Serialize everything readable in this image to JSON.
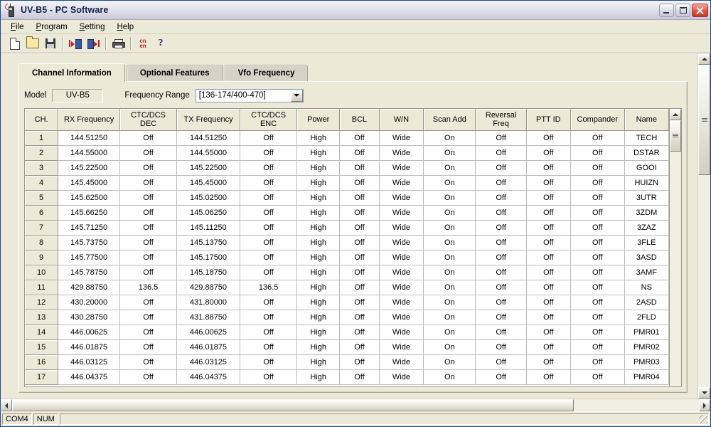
{
  "window": {
    "title": "UV-B5 - PC Software",
    "app_icon": "handheld-radio-icon",
    "minimize_label": "Minimize",
    "restore_label": "Restore",
    "close_label": "Close"
  },
  "menu": [
    {
      "label": "File",
      "accel": "F",
      "rest": "ile"
    },
    {
      "label": "Program",
      "accel": "P",
      "rest": "rogram"
    },
    {
      "label": "Setting",
      "accel": "S",
      "rest": "etting"
    },
    {
      "label": "Help",
      "accel": "H",
      "rest": "elp"
    }
  ],
  "toolbar": {
    "buttons": [
      "new-document-icon",
      "open-folder-icon",
      "save-floppy-icon",
      "read-from-radio-icon",
      "write-to-radio-icon",
      "print-icon",
      "language-cn-en-icon",
      "help-question-icon"
    ],
    "language_top": "cn",
    "language_bottom": "en",
    "help_glyph": "?"
  },
  "tabs": [
    {
      "label": "Channel Information",
      "active": true
    },
    {
      "label": "Optional Features",
      "active": false
    },
    {
      "label": "Vfo Frequency",
      "active": false
    }
  ],
  "fields": {
    "model_label": "Model",
    "model_value": "UV-B5",
    "frequency_range_label": "Frequency Range",
    "frequency_range_value": "[136-174/400-470]"
  },
  "grid": {
    "columns": [
      "CH.",
      "RX Frequency",
      "CTC/DCS DEC",
      "TX Frequency",
      "CTC/DCS ENC",
      "Power",
      "BCL",
      "W/N",
      "Scan Add",
      "Reversal Freq",
      "PTT ID",
      "Compander",
      "Name"
    ],
    "rows": [
      [
        "1",
        "144.51250",
        "Off",
        "144.51250",
        "Off",
        "High",
        "Off",
        "Wide",
        "On",
        "Off",
        "Off",
        "Off",
        "TECH"
      ],
      [
        "2",
        "144.55000",
        "Off",
        "144.55000",
        "Off",
        "High",
        "Off",
        "Wide",
        "On",
        "Off",
        "Off",
        "Off",
        "DSTAR"
      ],
      [
        "3",
        "145.22500",
        "Off",
        "145.22500",
        "Off",
        "High",
        "Off",
        "Wide",
        "On",
        "Off",
        "Off",
        "Off",
        "GOOI"
      ],
      [
        "4",
        "145.45000",
        "Off",
        "145.45000",
        "Off",
        "High",
        "Off",
        "Wide",
        "On",
        "Off",
        "Off",
        "Off",
        "HUIZN"
      ],
      [
        "5",
        "145.62500",
        "Off",
        "145.02500",
        "Off",
        "High",
        "Off",
        "Wide",
        "On",
        "Off",
        "Off",
        "Off",
        "3UTR"
      ],
      [
        "6",
        "145.66250",
        "Off",
        "145.06250",
        "Off",
        "High",
        "Off",
        "Wide",
        "On",
        "Off",
        "Off",
        "Off",
        "3ZDM"
      ],
      [
        "7",
        "145.71250",
        "Off",
        "145.11250",
        "Off",
        "High",
        "Off",
        "Wide",
        "On",
        "Off",
        "Off",
        "Off",
        "3ZAZ"
      ],
      [
        "8",
        "145.73750",
        "Off",
        "145.13750",
        "Off",
        "High",
        "Off",
        "Wide",
        "On",
        "Off",
        "Off",
        "Off",
        "3FLE"
      ],
      [
        "9",
        "145.77500",
        "Off",
        "145.17500",
        "Off",
        "High",
        "Off",
        "Wide",
        "On",
        "Off",
        "Off",
        "Off",
        "3ASD"
      ],
      [
        "10",
        "145.78750",
        "Off",
        "145.18750",
        "Off",
        "High",
        "Off",
        "Wide",
        "On",
        "Off",
        "Off",
        "Off",
        "3AMF"
      ],
      [
        "11",
        "429.88750",
        "136.5",
        "429.88750",
        "136.5",
        "High",
        "Off",
        "Wide",
        "On",
        "Off",
        "Off",
        "Off",
        "NS"
      ],
      [
        "12",
        "430.20000",
        "Off",
        "431.80000",
        "Off",
        "High",
        "Off",
        "Wide",
        "On",
        "Off",
        "Off",
        "Off",
        "2ASD"
      ],
      [
        "13",
        "430.28750",
        "Off",
        "431.88750",
        "Off",
        "High",
        "Off",
        "Wide",
        "On",
        "Off",
        "Off",
        "Off",
        "2FLD"
      ],
      [
        "14",
        "446.00625",
        "Off",
        "446.00625",
        "Off",
        "High",
        "Off",
        "Wide",
        "On",
        "Off",
        "Off",
        "Off",
        "PMR01"
      ],
      [
        "15",
        "446.01875",
        "Off",
        "446.01875",
        "Off",
        "High",
        "Off",
        "Wide",
        "On",
        "Off",
        "Off",
        "Off",
        "PMR02"
      ],
      [
        "16",
        "446.03125",
        "Off",
        "446.03125",
        "Off",
        "High",
        "Off",
        "Wide",
        "On",
        "Off",
        "Off",
        "Off",
        "PMR03"
      ],
      [
        "17",
        "446.04375",
        "Off",
        "446.04375",
        "Off",
        "High",
        "Off",
        "Wide",
        "On",
        "Off",
        "Off",
        "Off",
        "PMR04"
      ]
    ]
  },
  "statusbar": {
    "port": "COM4",
    "num_lock": "NUM"
  },
  "colors": {
    "face": "#ece9d8",
    "title_text": "#14224a",
    "close_button": "#d94a36",
    "grid_line": "#bdbdbd",
    "header_border": "#9a968a"
  }
}
